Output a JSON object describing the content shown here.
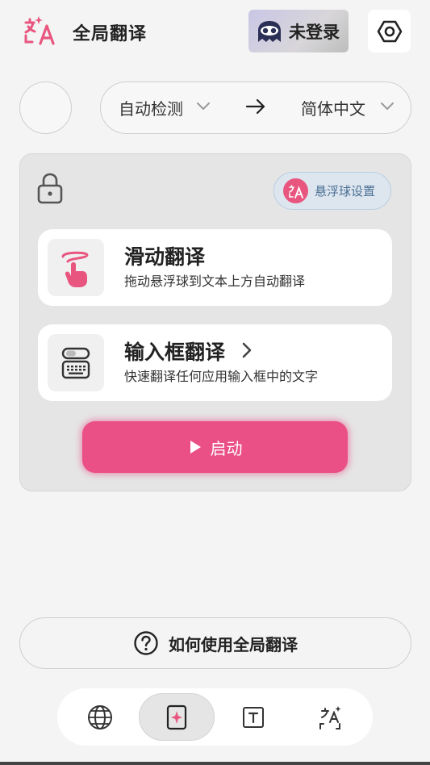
{
  "header": {
    "title": "全局翻译",
    "login_label": "未登录",
    "logo_icon": "translate-sparkle-icon",
    "settings_icon": "hexagon-gear-icon"
  },
  "language": {
    "source": "自动检测",
    "target": "简体中文",
    "arrow_icon": "arrow-right-icon"
  },
  "card": {
    "float_settings_label": "悬浮球设置",
    "features": [
      {
        "title": "滑动翻译",
        "desc": "拖动悬浮球到文本上方自动翻译",
        "icon": "swipe-hand-icon"
      },
      {
        "title": "输入框翻译",
        "desc": "快速翻译任何应用输入框中的文字",
        "icon": "keyboard-icon"
      }
    ],
    "start_label": "启动"
  },
  "help": {
    "label": "如何使用全局翻译"
  },
  "nav": {
    "items": [
      {
        "icon": "globe-icon",
        "active": false
      },
      {
        "icon": "sparkle-card-icon",
        "active": true
      },
      {
        "icon": "text-box-icon",
        "active": false
      },
      {
        "icon": "translate-upload-icon",
        "active": false
      }
    ]
  },
  "colors": {
    "accent": "#ea4f86",
    "background": "#f4f4f4",
    "card": "#e5e5e5"
  }
}
